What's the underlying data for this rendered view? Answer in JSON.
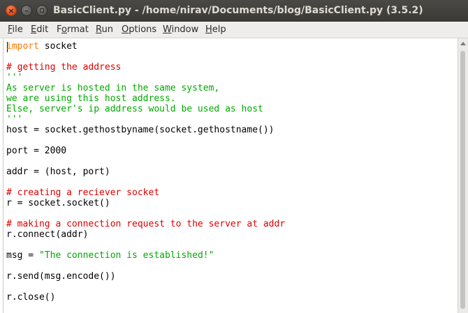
{
  "window": {
    "title": "BasicClient.py - /home/nirav/Documents/blog/BasicClient.py (3.5.2)",
    "close_glyph": "×",
    "minimize_glyph": "–"
  },
  "menu": [
    {
      "mnemonic": "F",
      "rest": "ile"
    },
    {
      "mnemonic": "E",
      "rest": "dit"
    },
    {
      "pre": "F",
      "mnemonic": "o",
      "rest": "rmat"
    },
    {
      "mnemonic": "R",
      "rest": "un"
    },
    {
      "mnemonic": "O",
      "rest": "ptions"
    },
    {
      "mnemonic": "W",
      "rest": "indow"
    },
    {
      "mnemonic": "H",
      "rest": "elp"
    }
  ],
  "colors": {
    "keyword": "#ff7700",
    "comment": "#dd0000",
    "string": "#00aa00",
    "default": "#000000"
  },
  "code_lines": [
    [
      {
        "t": "import",
        "c": "keyword"
      },
      {
        "t": " socket"
      }
    ],
    [],
    [
      {
        "t": "# getting the address",
        "c": "comment"
      }
    ],
    [
      {
        "t": "'''",
        "c": "string"
      }
    ],
    [
      {
        "t": "As server is hosted in the same system,",
        "c": "string"
      }
    ],
    [
      {
        "t": "we are using this host address.",
        "c": "string"
      }
    ],
    [
      {
        "t": "Else, server's ip address would be used as host",
        "c": "string"
      }
    ],
    [
      {
        "t": "'''",
        "c": "string"
      }
    ],
    [
      {
        "t": "host = socket.gethostbyname(socket.gethostname())"
      }
    ],
    [],
    [
      {
        "t": "port = 2000"
      }
    ],
    [],
    [
      {
        "t": "addr = (host, port)"
      }
    ],
    [],
    [
      {
        "t": "# creating a reciever socket",
        "c": "comment"
      }
    ],
    [
      {
        "t": "r = socket.socket()"
      }
    ],
    [],
    [
      {
        "t": "# making a connection request to the server at addr",
        "c": "comment"
      }
    ],
    [
      {
        "t": "r.connect(addr)"
      }
    ],
    [],
    [
      {
        "t": "msg = "
      },
      {
        "t": "\"The connection is established!\"",
        "c": "string"
      }
    ],
    [],
    [
      {
        "t": "r.send(msg.encode())"
      }
    ],
    [],
    [
      {
        "t": "r.close()"
      }
    ]
  ]
}
